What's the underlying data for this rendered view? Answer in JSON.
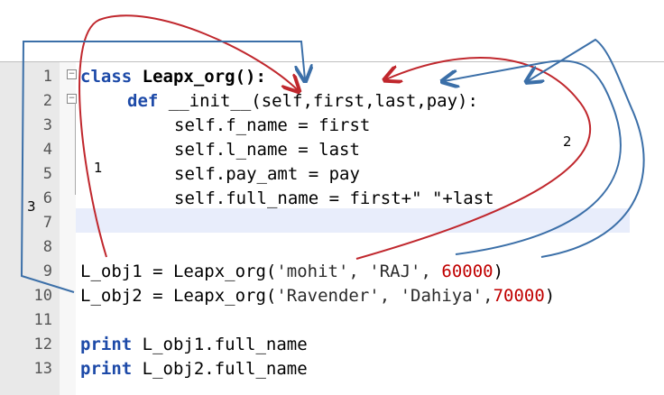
{
  "line_numbers": [
    "1",
    "2",
    "3",
    "4",
    "5",
    "6",
    "7",
    "8",
    "9",
    "10",
    "11",
    "12",
    "13"
  ],
  "code": {
    "l1_kw": "class",
    "l1_rest": " Leapx_org():",
    "l2_kw": "def",
    "l2_rest": " __init__(self,first,last,pay):",
    "l3": "self.f_name = first",
    "l4": "self.l_name = last",
    "l5": "self.pay_amt = pay",
    "l6": "self.full_name = first+\" \"+last",
    "l9_a": "L_obj1 = Leapx_org(",
    "l9_s": "'mohit', 'RAJ', ",
    "l9_n": "60000",
    "l9_e": ")",
    "l10_a": "L_obj2 = Leapx_org(",
    "l10_s": "'Ravender', 'Dahiya',",
    "l10_n": "70000",
    "l10_e": ")",
    "l12_kw": "print",
    "l12_rest": " L_obj1.full_name",
    "l13_kw": "print",
    "l13_rest": " L_obj2.full_name"
  },
  "annotations": {
    "label_1": "1",
    "label_2": "2",
    "label_3": "3"
  },
  "colors": {
    "red_arrow": "#c0272d",
    "blue_arrow": "#3b6fa8",
    "keyword": "#1d4aa8",
    "number": "#c00000"
  }
}
